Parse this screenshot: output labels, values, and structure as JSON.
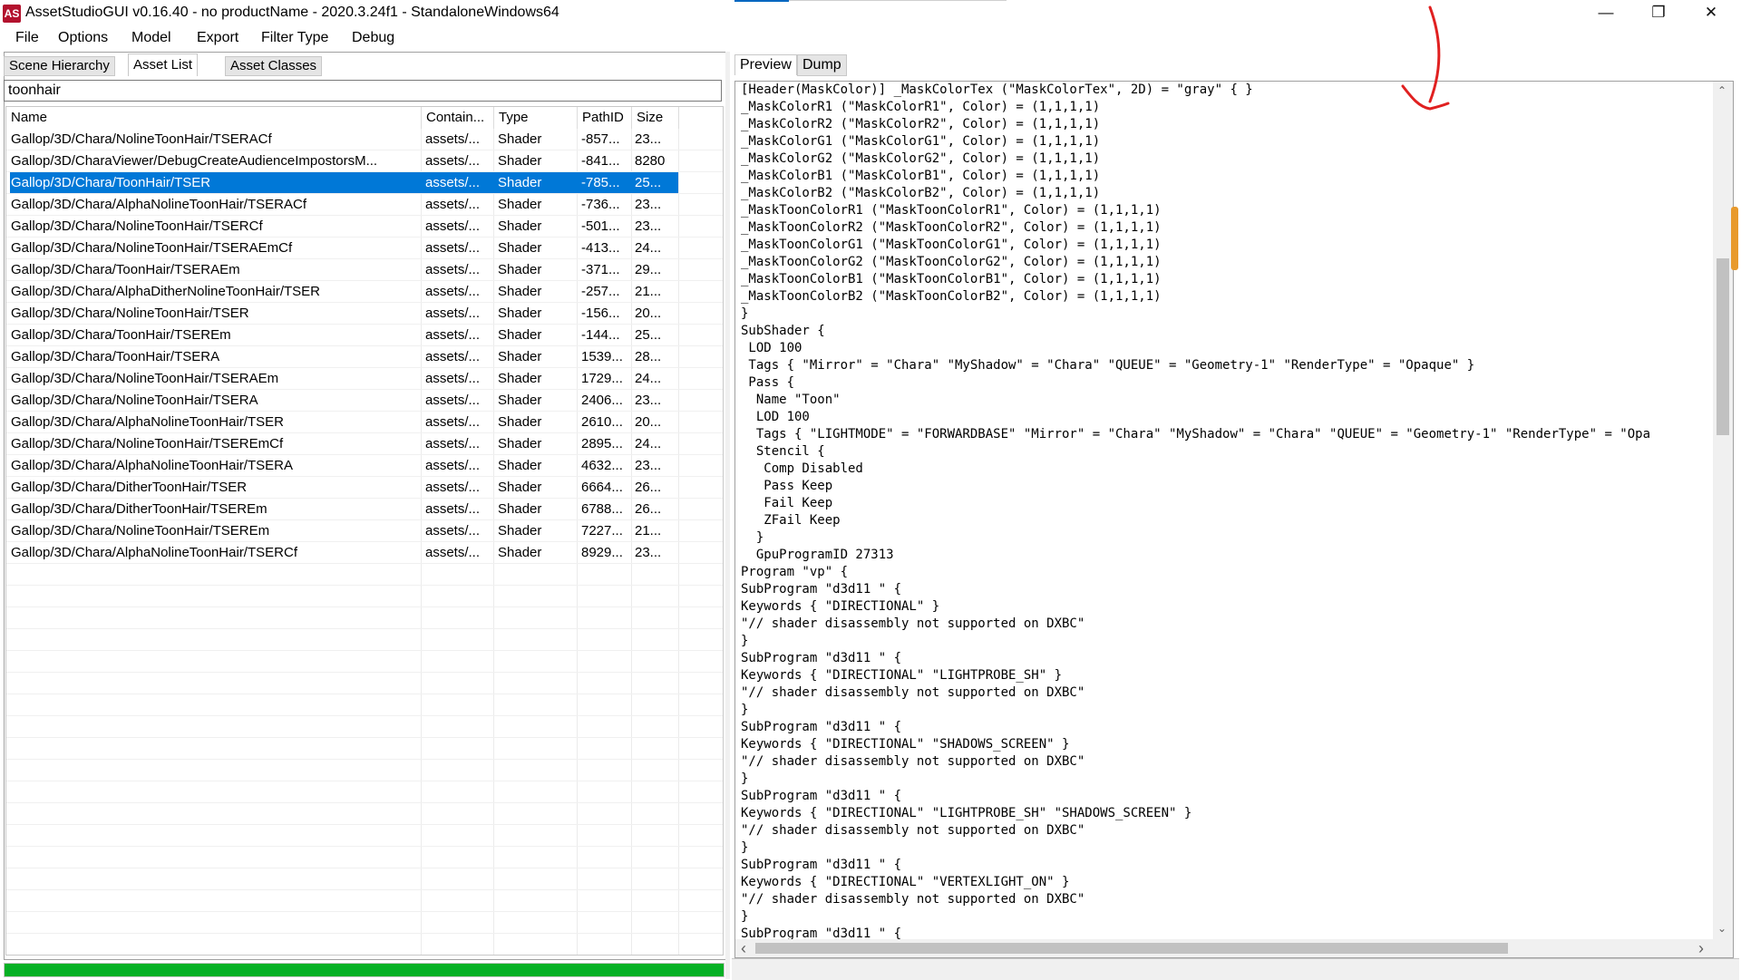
{
  "window": {
    "title": "AssetStudioGUI v0.16.40 - no productName - 2020.3.24f1 - StandaloneWindows64",
    "app_icon_text": "AS",
    "minimize_glyph": "—",
    "maximize_glyph": "❐",
    "close_glyph": "✕"
  },
  "menu": [
    "File",
    "Options",
    "Model",
    "Export",
    "Filter Type",
    "Debug"
  ],
  "left_tabs": [
    "Scene Hierarchy",
    "Asset List",
    "Asset Classes"
  ],
  "search": {
    "value": "toonhair",
    "placeholder": ""
  },
  "columns": [
    "Name",
    "Contain...",
    "Type",
    "PathID",
    "Size"
  ],
  "rows": [
    {
      "name": "Gallop/3D/Chara/NolineToonHair/TSERACf",
      "container": "assets/...",
      "type": "Shader",
      "pathid": "-857...",
      "size": "23..."
    },
    {
      "name": "Gallop/3D/CharaViewer/DebugCreateAudienceImpostorsM...",
      "container": "assets/...",
      "type": "Shader",
      "pathid": "-841...",
      "size": "8280"
    },
    {
      "name": "Gallop/3D/Chara/ToonHair/TSER",
      "container": "assets/...",
      "type": "Shader",
      "pathid": "-785...",
      "size": "25...",
      "selected": true
    },
    {
      "name": "Gallop/3D/Chara/AlphaNolineToonHair/TSERACf",
      "container": "assets/...",
      "type": "Shader",
      "pathid": "-736...",
      "size": "23..."
    },
    {
      "name": "Gallop/3D/Chara/NolineToonHair/TSERCf",
      "container": "assets/...",
      "type": "Shader",
      "pathid": "-501...",
      "size": "23..."
    },
    {
      "name": "Gallop/3D/Chara/NolineToonHair/TSERAEmCf",
      "container": "assets/...",
      "type": "Shader",
      "pathid": "-413...",
      "size": "24..."
    },
    {
      "name": "Gallop/3D/Chara/ToonHair/TSERAEm",
      "container": "assets/...",
      "type": "Shader",
      "pathid": "-371...",
      "size": "29..."
    },
    {
      "name": "Gallop/3D/Chara/AlphaDitherNolineToonHair/TSER",
      "container": "assets/...",
      "type": "Shader",
      "pathid": "-257...",
      "size": "21..."
    },
    {
      "name": "Gallop/3D/Chara/NolineToonHair/TSER",
      "container": "assets/...",
      "type": "Shader",
      "pathid": "-156...",
      "size": "20..."
    },
    {
      "name": "Gallop/3D/Chara/ToonHair/TSEREm",
      "container": "assets/...",
      "type": "Shader",
      "pathid": "-144...",
      "size": "25..."
    },
    {
      "name": "Gallop/3D/Chara/ToonHair/TSERA",
      "container": "assets/...",
      "type": "Shader",
      "pathid": "1539...",
      "size": "28..."
    },
    {
      "name": "Gallop/3D/Chara/NolineToonHair/TSERAEm",
      "container": "assets/...",
      "type": "Shader",
      "pathid": "1729...",
      "size": "24..."
    },
    {
      "name": "Gallop/3D/Chara/NolineToonHair/TSERA",
      "container": "assets/...",
      "type": "Shader",
      "pathid": "2406...",
      "size": "23..."
    },
    {
      "name": "Gallop/3D/Chara/AlphaNolineToonHair/TSER",
      "container": "assets/...",
      "type": "Shader",
      "pathid": "2610...",
      "size": "20..."
    },
    {
      "name": "Gallop/3D/Chara/NolineToonHair/TSEREmCf",
      "container": "assets/...",
      "type": "Shader",
      "pathid": "2895...",
      "size": "24..."
    },
    {
      "name": "Gallop/3D/Chara/AlphaNolineToonHair/TSERA",
      "container": "assets/...",
      "type": "Shader",
      "pathid": "4632...",
      "size": "23..."
    },
    {
      "name": "Gallop/3D/Chara/DitherToonHair/TSER",
      "container": "assets/...",
      "type": "Shader",
      "pathid": "6664...",
      "size": "26..."
    },
    {
      "name": "Gallop/3D/Chara/DitherToonHair/TSEREm",
      "container": "assets/...",
      "type": "Shader",
      "pathid": "6788...",
      "size": "26..."
    },
    {
      "name": "Gallop/3D/Chara/NolineToonHair/TSEREm",
      "container": "assets/...",
      "type": "Shader",
      "pathid": "7227...",
      "size": "21..."
    },
    {
      "name": "Gallop/3D/Chara/AlphaNolineToonHair/TSERCf",
      "container": "assets/...",
      "type": "Shader",
      "pathid": "8929...",
      "size": "23..."
    }
  ],
  "right_tabs": [
    "Preview",
    "Dump"
  ],
  "code_lines": [
    "[Header(MaskColor)] _MaskColorTex (\"MaskColorTex\", 2D) = \"gray\" { }",
    "_MaskColorR1 (\"MaskColorR1\", Color) = (1,1,1,1)",
    "_MaskColorR2 (\"MaskColorR2\", Color) = (1,1,1,1)",
    "_MaskColorG1 (\"MaskColorG1\", Color) = (1,1,1,1)",
    "_MaskColorG2 (\"MaskColorG2\", Color) = (1,1,1,1)",
    "_MaskColorB1 (\"MaskColorB1\", Color) = (1,1,1,1)",
    "_MaskColorB2 (\"MaskColorB2\", Color) = (1,1,1,1)",
    "_MaskToonColorR1 (\"MaskToonColorR1\", Color) = (1,1,1,1)",
    "_MaskToonColorR2 (\"MaskToonColorR2\", Color) = (1,1,1,1)",
    "_MaskToonColorG1 (\"MaskToonColorG1\", Color) = (1,1,1,1)",
    "_MaskToonColorG2 (\"MaskToonColorG2\", Color) = (1,1,1,1)",
    "_MaskToonColorB1 (\"MaskToonColorB1\", Color) = (1,1,1,1)",
    "_MaskToonColorB2 (\"MaskToonColorB2\", Color) = (1,1,1,1)",
    "}",
    "SubShader {",
    " LOD 100",
    " Tags { \"Mirror\" = \"Chara\" \"MyShadow\" = \"Chara\" \"QUEUE\" = \"Geometry-1\" \"RenderType\" = \"Opaque\" }",
    " Pass {",
    "  Name \"Toon\"",
    "  LOD 100",
    "  Tags { \"LIGHTMODE\" = \"FORWARDBASE\" \"Mirror\" = \"Chara\" \"MyShadow\" = \"Chara\" \"QUEUE\" = \"Geometry-1\" \"RenderType\" = \"Opa",
    "  Stencil {",
    "   Comp Disabled",
    "   Pass Keep",
    "   Fail Keep",
    "   ZFail Keep",
    "  }",
    "  GpuProgramID 27313",
    "Program \"vp\" {",
    "SubProgram \"d3d11 \" {",
    "Keywords { \"DIRECTIONAL\" }",
    "\"// shader disassembly not supported on DXBC\"",
    "}",
    "SubProgram \"d3d11 \" {",
    "Keywords { \"DIRECTIONAL\" \"LIGHTPROBE_SH\" }",
    "\"// shader disassembly not supported on DXBC\"",
    "}",
    "SubProgram \"d3d11 \" {",
    "Keywords { \"DIRECTIONAL\" \"SHADOWS_SCREEN\" }",
    "\"// shader disassembly not supported on DXBC\"",
    "}",
    "SubProgram \"d3d11 \" {",
    "Keywords { \"DIRECTIONAL\" \"LIGHTPROBE_SH\" \"SHADOWS_SCREEN\" }",
    "\"// shader disassembly not supported on DXBC\"",
    "}",
    "SubProgram \"d3d11 \" {",
    "Keywords { \"DIRECTIONAL\" \"VERTEXLIGHT_ON\" }",
    "\"// shader disassembly not supported on DXBC\"",
    "}",
    "SubProgram \"d3d11 \" {"
  ],
  "scroll_glyphs": {
    "up": "⌃",
    "down": "⌄",
    "left": "‹",
    "right": "›"
  },
  "colors": {
    "selection": "#0078d7",
    "progress": "#06b025",
    "annotation": "#e02020",
    "scroll_marker": "#e89a2c"
  },
  "annotation": {
    "shape": "red-hand-drawn-arrow-icon"
  },
  "progress_fraction": 1.0
}
